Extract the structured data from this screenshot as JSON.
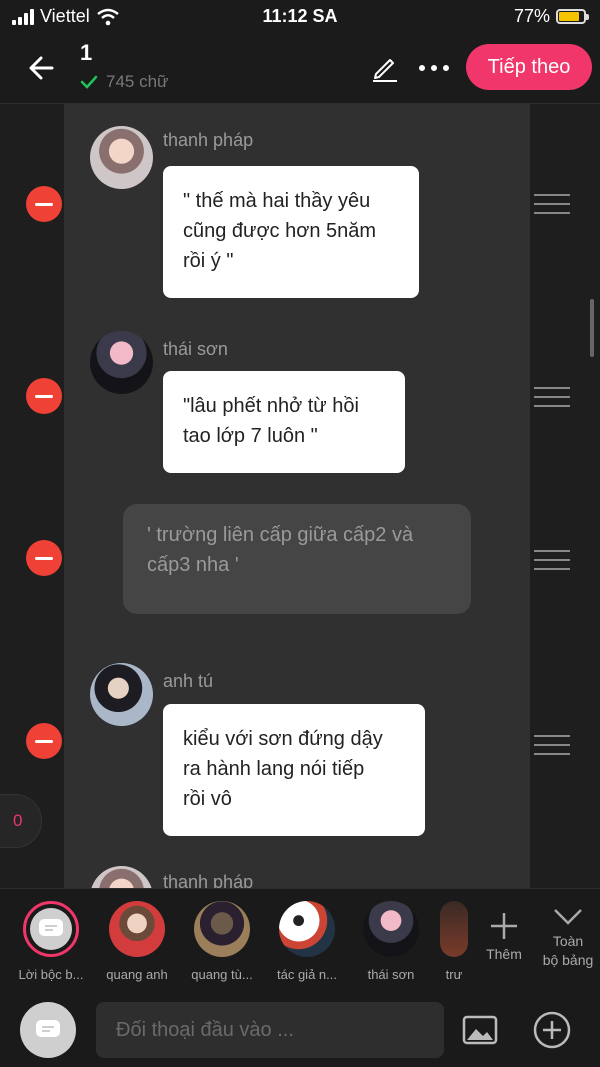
{
  "status": {
    "carrier": "Viettel",
    "time": "11:12 SA",
    "battery": "77%",
    "battery_level": 0.77
  },
  "header": {
    "title": "1",
    "word_count": "745 chữ",
    "next_label": "Tiếp theo"
  },
  "messages": [
    {
      "type": "dialog",
      "speaker": "thanh pháp",
      "lines": [
        "\" thế mà hai thầy yêu",
        "cũng được hơn 5năm",
        "rồi ý \""
      ]
    },
    {
      "type": "dialog",
      "speaker": "thái sơn",
      "lines": [
        "\"lâu phết nhở từ hồi",
        "tao lớp 7 luôn \""
      ]
    },
    {
      "type": "narration",
      "lines": [
        "' trường liên cấp giữa cấp2 và",
        "cấp3 nha '"
      ]
    },
    {
      "type": "dialog",
      "speaker": "anh tú",
      "lines": [
        "kiểu với sơn đứng dậy",
        "ra hành lang nói tiếp",
        "rồi vô"
      ]
    },
    {
      "type": "dialog",
      "speaker": "thanh pháp"
    }
  ],
  "counter": "0",
  "characters": [
    {
      "label": "Lời bộc b..."
    },
    {
      "label": "quang anh"
    },
    {
      "label": "quang tù..."
    },
    {
      "label": "tác giả n..."
    },
    {
      "label": "thái sơn"
    },
    {
      "label": "trư"
    }
  ],
  "strip": {
    "add_label": "Thêm",
    "all_label_1": "Toàn",
    "all_label_2": "bộ bảng"
  },
  "composer": {
    "placeholder": "Đối thoại đầu vào ..."
  },
  "colors": {
    "accent": "#f0366a",
    "remove": "#ef4135",
    "bubble": "#ffffff",
    "narration": "#454545"
  },
  "icons": [
    "back-arrow-icon",
    "check-icon",
    "pencil-icon",
    "more-icon",
    "minus-icon",
    "drag-handle-icon",
    "plus-icon",
    "chevron-down-icon",
    "image-icon",
    "plus-circle-icon",
    "speech-icon"
  ]
}
